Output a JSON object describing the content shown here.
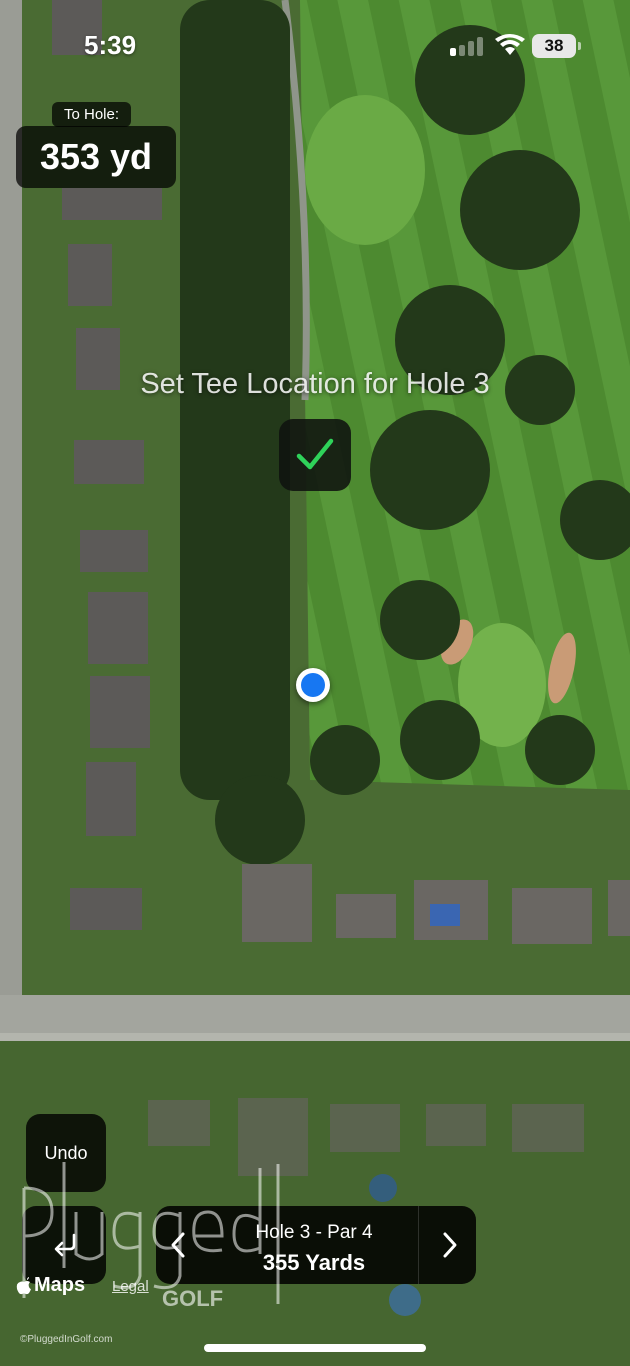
{
  "status_bar": {
    "time": "5:39",
    "battery_level": "38",
    "signal_bars_active": 1,
    "signal_bars_total": 4
  },
  "distance": {
    "label": "To Hole:",
    "value": "353 yd"
  },
  "set_tee": {
    "title": "Set Tee Location for Hole 3",
    "confirm_icon": "checkmark-icon",
    "confirm_color": "#2fd25a"
  },
  "undo": {
    "label": "Undo"
  },
  "hole_nav": {
    "hole_label": "Hole 3 - Par 4",
    "yards_label": "355 Yards",
    "back_icon": "return-arrow-icon",
    "prev_icon": "chevron-left-icon",
    "next_icon": "chevron-right-icon"
  },
  "attribution": {
    "maps_label": "Maps",
    "legal_label": "Legal"
  },
  "watermark": {
    "logo_text": "plugged in GOLF",
    "copyright": "©PluggedInGolf.com"
  },
  "colors": {
    "location_dot": "#1777f2",
    "fairway": "#4e8a32",
    "rough": "#2b4a1f"
  }
}
